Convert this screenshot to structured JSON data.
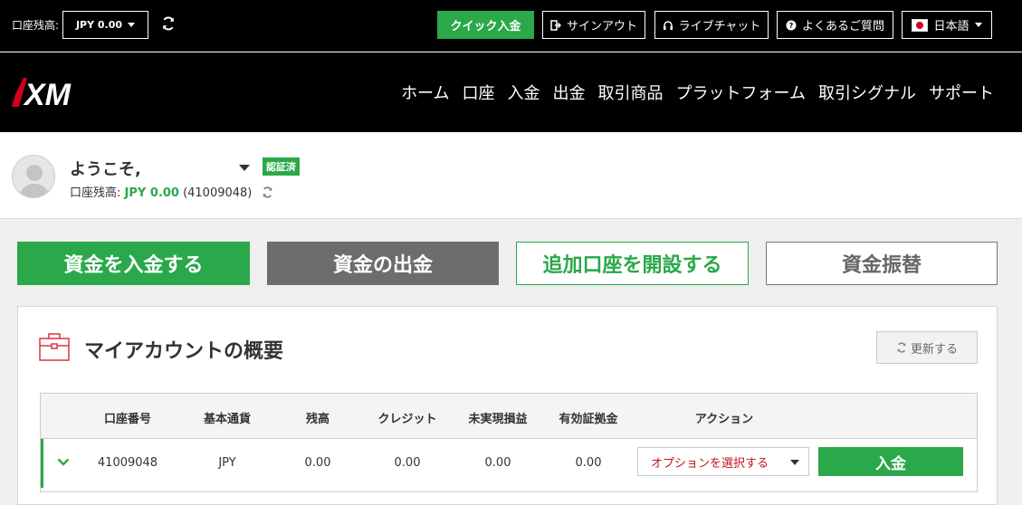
{
  "topbar": {
    "balance_label": "口座残高:",
    "balance_value": "JPY 0.00",
    "quick_deposit": "クイック入金",
    "signout": "サインアウト",
    "live_chat": "ライブチャット",
    "faq": "よくあるご質問",
    "language": "日本語"
  },
  "brand": {
    "logo_text": "XM",
    "accent": "#2aa84a",
    "danger": "#c0161c"
  },
  "nav": {
    "items": [
      "ホーム",
      "口座",
      "入金",
      "出金",
      "取引商品",
      "プラットフォーム",
      "取引シグナル",
      "サポート"
    ]
  },
  "welcome": {
    "greeting": "ようこそ,",
    "verified_badge": "認証済",
    "balance_label": "口座残高:",
    "balance_amount": "JPY 0.00",
    "account_ref": "(41009048)"
  },
  "actions": {
    "deposit": "資金を入金する",
    "withdraw": "資金の出金",
    "open_account": "追加口座を開設する",
    "transfer": "資金振替"
  },
  "overview": {
    "title": "マイアカウントの概要",
    "refresh": "更新する",
    "columns": [
      "口座番号",
      "基本通貨",
      "残高",
      "クレジット",
      "未実現損益",
      "有効証拠金",
      "アクション"
    ],
    "rows": [
      {
        "account": "41009048",
        "currency": "JPY",
        "balance": "0.00",
        "credit": "0.00",
        "unrealized": "0.00",
        "equity": "0.00",
        "option_placeholder": "オプションを選択する",
        "deposit": "入金"
      }
    ]
  }
}
